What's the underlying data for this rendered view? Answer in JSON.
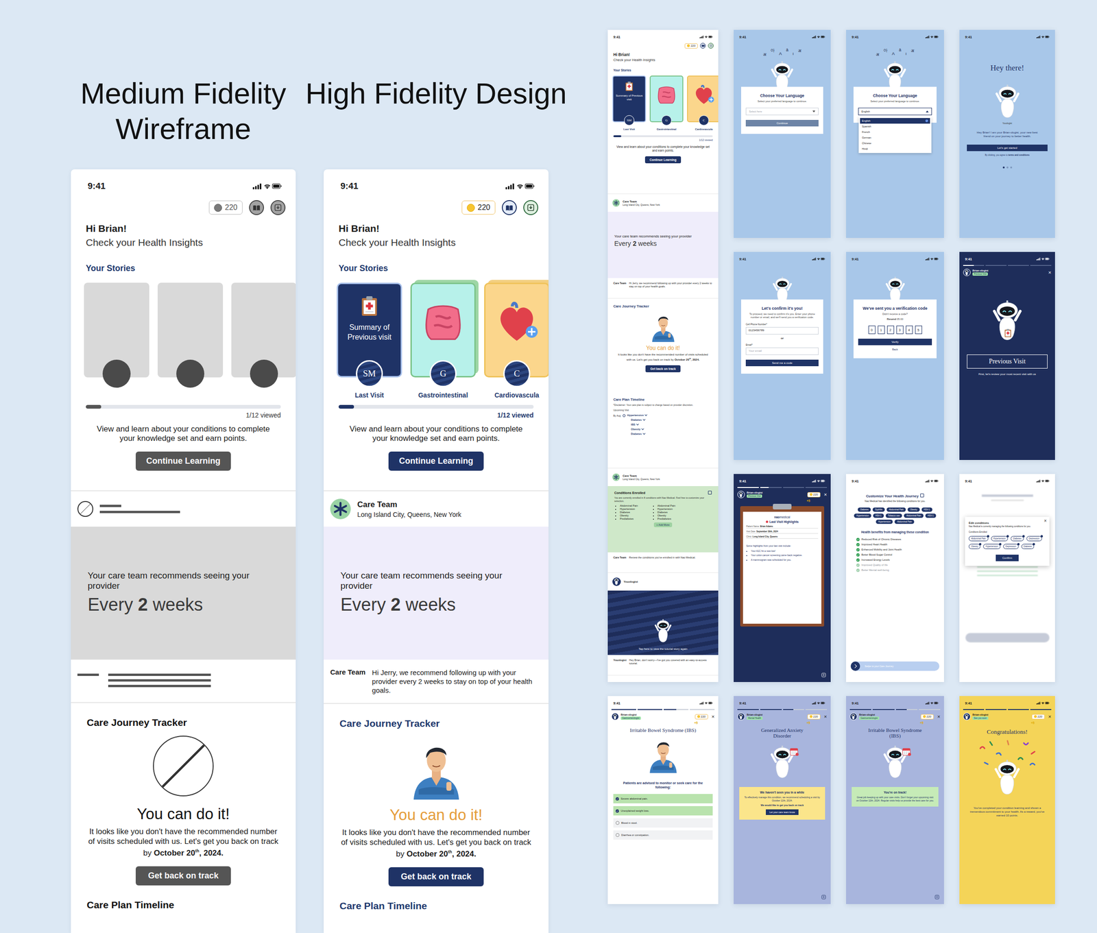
{
  "phones": [
    {
      "kind": "wireframe",
      "heading": "Medium Fidelity Wireframe"
    },
    {
      "kind": "hifi",
      "heading": "High Fidelity Design"
    }
  ],
  "home": {
    "time": "9:41",
    "points": "220",
    "greeting": "Hi Brian!",
    "subtitle": "Check your Health Insights",
    "storiesTitle": "Your Stories",
    "stories": [
      {
        "title": "Summary of Previous visit",
        "badge": "SM",
        "label": "Last Visit",
        "selected": true,
        "color": "#1f3366"
      },
      {
        "badge": "G",
        "label": "Gastrointestinal",
        "selected": false,
        "color": "#b7f1ea"
      },
      {
        "badge": "C",
        "label": "Cardiovascula",
        "selected": false,
        "color": "#fbd68c"
      }
    ],
    "progress": {
      "level": 0.08,
      "text": "1/12 viewed"
    },
    "description": "View and learn about your conditions to complete your knowledge set and earn points.",
    "continueButton": "Continue Learning",
    "careTeam": {
      "name": "Care Team",
      "location": "Long Island City, Queens, New York"
    },
    "recommendation": {
      "text": "Your care team recommends seeing your provider",
      "every": "Every",
      "number": "2",
      "unit": "weeks"
    },
    "message": {
      "sender": "Care Team",
      "text": "Hi Jerry, we recommend following up with your provider every 2 weeks to stay on top of your health goals."
    },
    "tracker": {
      "title": "Care Journey Tracker",
      "headline": "You can do it!",
      "body": "It looks like you don't have the recommended number of visits scheduled with us. Let's get you back on track by ",
      "date": "October 20",
      "dateSup": "th",
      "dateEnd": ", 2024.",
      "button": "Get back on track"
    },
    "timelineTitle": "Care Plan Timeline"
  },
  "longScreen": {
    "timeline": {
      "disclaimer": "*Disclaimer: Your care plan is subject to change based on provider discretion.",
      "upcoming": "Upcoming Visit",
      "by": "By Aug",
      "items": [
        "Hypertension",
        "Diabetes",
        "IBS",
        "Obesity",
        "Diabetes"
      ]
    },
    "conditions": {
      "title": "Conditions Enrolled",
      "text": "You are currently enrolled in 8 conditions with Nao Medical. Feel free to customize your selection.",
      "left": [
        "Abdominal Pain",
        "Hypertension",
        "Diabetes",
        "Obesity",
        "Prediabetes"
      ],
      "right": [
        "Abdominal Pain",
        "Hypertension",
        "Diabetes",
        "Obesity",
        "Prediabetes"
      ],
      "add": "+ Add More",
      "sender": "Care Team",
      "note": "Review the conditions you've enrolled in with Nao Medical."
    },
    "tutorial": {
      "name": "Youologist",
      "cta": "Tap here to view the tutorial story again",
      "sender": "Youologist",
      "note": "Hey Brian, don't worry—I've got you covered with an easy-to-access tutorial."
    }
  },
  "screens": [
    {
      "kind": "language",
      "time": "9:41",
      "glyphs": [
        "अ",
        "아",
        "A",
        "ā",
        "ı",
        "अ"
      ],
      "title": "Choose Your Language",
      "subtitle": "Select your preferred language to continue.",
      "placeholder": "Select here",
      "button": "Continue",
      "disabled": true
    },
    {
      "kind": "language-open",
      "time": "9:41",
      "glyphs": [
        "अ",
        "아",
        "A",
        "ā",
        "ı",
        "अ"
      ],
      "title": "Choose Your Language",
      "subtitle": "Select your preferred language to continue.",
      "value": "English",
      "options": [
        {
          "label": "English",
          "selected": true
        },
        {
          "label": "Spanish",
          "selected": false
        },
        {
          "label": "French",
          "selected": false
        },
        {
          "label": "German",
          "selected": false
        },
        {
          "label": "Chinese",
          "selected": false
        },
        {
          "label": "Hindi",
          "selected": false
        }
      ]
    },
    {
      "kind": "welcome",
      "time": "9:41",
      "title": "Hey there!",
      "robotLabel": "Youologist",
      "text": "Hey Brian! I am your Brian-ologist, your new best friend on your journey to better health.",
      "button": "Let's get started",
      "legal": "By clicking, you agree to ",
      "legalLink": "terms and conditions",
      "dots": [
        {
          "selected": true
        },
        {
          "selected": false
        },
        {
          "selected": false
        }
      ]
    },
    {
      "kind": "confirm",
      "time": "9:41",
      "title": "Let's confirm it's you!",
      "text": "To proceed, we need to confirm it's you. Enter your phone number or email, and we'll send you a verification code.",
      "phoneLabel": "Cell Phone Number*",
      "phoneValue": "0123456789",
      "or": "or",
      "emailLabel": "Email*",
      "emailPlaceholder": "Your email",
      "button": "Send me a code"
    },
    {
      "kind": "verify",
      "time": "9:41",
      "title": "We've sent you a verification code",
      "hint": "Didn't receive a code?",
      "resend": "Resend",
      "timer": "05:00",
      "digits": [
        "0",
        "1",
        "2",
        "3",
        "4",
        "5"
      ],
      "button": "Verify",
      "back": "Back"
    },
    {
      "kind": "intro",
      "time": "9:41",
      "segments": [
        {
          "level": 0.5
        },
        {
          "level": 0
        },
        {
          "level": 0
        },
        {
          "level": 0
        }
      ],
      "name": "Brian-ologist",
      "tag": "Previous Visit",
      "close": "×",
      "title": "Previous Visit",
      "text": "First, let's review your most recent visit with us"
    },
    {
      "kind": "highlights",
      "time": "9:41",
      "segments": [
        {
          "level": 1
        },
        {
          "level": 0.4
        },
        {
          "level": 0
        },
        {
          "level": 0
        }
      ],
      "name": "Brian-ologist",
      "tag": "Previous Visit",
      "points": "220",
      "close": "×",
      "bonus": "+5",
      "brand": "nao",
      "brandSuffix": "medical",
      "title": "Last Visit Highlights",
      "fields": [
        {
          "label": "Patient Name:",
          "value": "Brian Adams"
        },
        {
          "label": "Visit Date:",
          "value": "September 30th, 2024"
        },
        {
          "label": "Clinic:",
          "value": "Long Island City, Queens"
        }
      ],
      "intro": "Some highlights from your last visit include:",
      "bullets": [
        "Your A1C hit a new low!",
        "Your colon cancer screening came back negative.",
        "A mammogram was scheduled for you."
      ]
    },
    {
      "kind": "customize",
      "time": "9:41",
      "title": "Customize Your Health Journey",
      "subtitle": "Nao Medical has identified the following conditions for you.",
      "chips": [
        "Diabetes",
        "Syphilis",
        "Abdominal Pain",
        "Obesity",
        "HSV-1",
        "Hypertension",
        "HSV-1",
        "Tobacco use",
        "Abdominal Pain",
        "HSV-1",
        "Hypertension",
        "Abdominal Pain"
      ],
      "benefitsTitle": "Health benefits from managing these condition",
      "benefits": [
        {
          "label": "Reduced Risk of Chronic Diseases",
          "faded": false
        },
        {
          "label": "Improved Heart Health",
          "faded": false
        },
        {
          "label": "Enhanced Mobility and Joint Health",
          "faded": false
        },
        {
          "label": "Better Blood Sugar Control",
          "faded": false
        },
        {
          "label": "Increased Energy Levels",
          "faded": false
        },
        {
          "label": "Improved Quality of life",
          "faded": true
        },
        {
          "label": "Better Mental well-being",
          "faded": true
        }
      ],
      "swipe": "Swipe to your Care Journey"
    },
    {
      "kind": "edit",
      "time": "9:41",
      "title": "Edit conditions",
      "text": "Nao Medical is currently managing the following conditions for you.",
      "label": "Conditions Enrolled",
      "chips": [
        "Abdominal Pain",
        "Hypertension",
        "Diabetes",
        "Depression",
        "Obesity",
        "Hypertension",
        "Depression",
        "Diabetes"
      ],
      "button": "Confirm",
      "close": "×"
    },
    {
      "kind": "checklist",
      "time": "9:41",
      "segments": [
        {
          "level": 1
        },
        {
          "level": 1
        },
        {
          "level": 0.5
        },
        {
          "level": 0
        }
      ],
      "name": "Brian-ologist",
      "tag": "Gastroenterologist",
      "points": "220",
      "close": "×",
      "bonus": "+5",
      "title": "Irritable Bowel Syndrome (IBS)",
      "prompt": "Patients are advised to monitor or seek care for the following:",
      "items": [
        {
          "label": "Severe abdominal pain.",
          "checked": true
        },
        {
          "label": "Unexplained weight loss.",
          "checked": true
        },
        {
          "label": "Blood in stool.",
          "checked": false
        },
        {
          "label": "Diarrhea or constipation.",
          "checked": false
        }
      ]
    },
    {
      "kind": "offtrack",
      "time": "9:41",
      "segments": [
        {
          "level": 1
        },
        {
          "level": 1
        },
        {
          "level": 0.5
        },
        {
          "level": 0
        }
      ],
      "name": "Brian-ologist",
      "tag": "Mental Health",
      "points": "220",
      "close": "×",
      "bonus": "+5",
      "title": "Generalized Anxiety Disorder",
      "cardTitle": "We haven't seen you in a while",
      "text": "To effectively manage this condition, we recommend scheduling a visit by October 12th, 2024.",
      "ask": "We would like to get you back on track",
      "button": "Let your care team know"
    },
    {
      "kind": "ontrack",
      "time": "9:41",
      "segments": [
        {
          "level": 1
        },
        {
          "level": 1
        },
        {
          "level": 0.5
        },
        {
          "level": 0
        }
      ],
      "name": "Brian-ologist",
      "tag": "Gastroenterologist",
      "points": "220",
      "close": "×",
      "bonus": "+5",
      "title": "Irritable Bowel Syndrome (IBS)",
      "cardTitle": "You're on track!",
      "text": "Great job keeping up with your care visits. Don't forget your upcoming visit on October 12th, 2024. Regular visits help us provide the best care for you."
    },
    {
      "kind": "congrats",
      "time": "9:41",
      "segments": [
        {
          "level": 1
        },
        {
          "level": 1
        },
        {
          "level": 1
        },
        {
          "level": 1
        }
      ],
      "name": "Brian-ologist",
      "tag": "See you soon",
      "points": "220",
      "close": "×",
      "bonus": "+5",
      "title": "Congratulations!",
      "text": "You've completed your condition learning and shown a tremendous commitment to your health. As a reward, you've earned 10 points."
    }
  ]
}
